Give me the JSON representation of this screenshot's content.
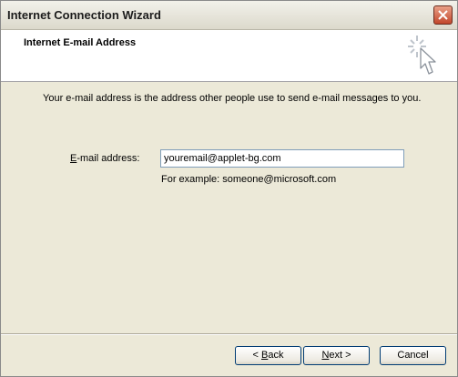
{
  "window": {
    "title": "Internet Connection Wizard"
  },
  "header": {
    "title": "Internet E-mail Address"
  },
  "main": {
    "description": "Your e-mail address is the address other people use to send e-mail messages to you.",
    "email_label_mnemonic": "E",
    "email_label_rest": "-mail address:",
    "email_value": "youremail@applet-bg.com",
    "example": "For example: someone@microsoft.com"
  },
  "buttons": {
    "back_prefix": "< ",
    "back_mnemonic": "B",
    "back_rest": "ack",
    "next_mnemonic": "N",
    "next_rest": "ext >",
    "cancel": "Cancel"
  },
  "icons": {
    "close": "close-icon",
    "wizard": "wizard-cursor-icon"
  },
  "colors": {
    "close_button": "#c2472c",
    "input_border": "#7f9db9",
    "button_border": "#003c74"
  }
}
